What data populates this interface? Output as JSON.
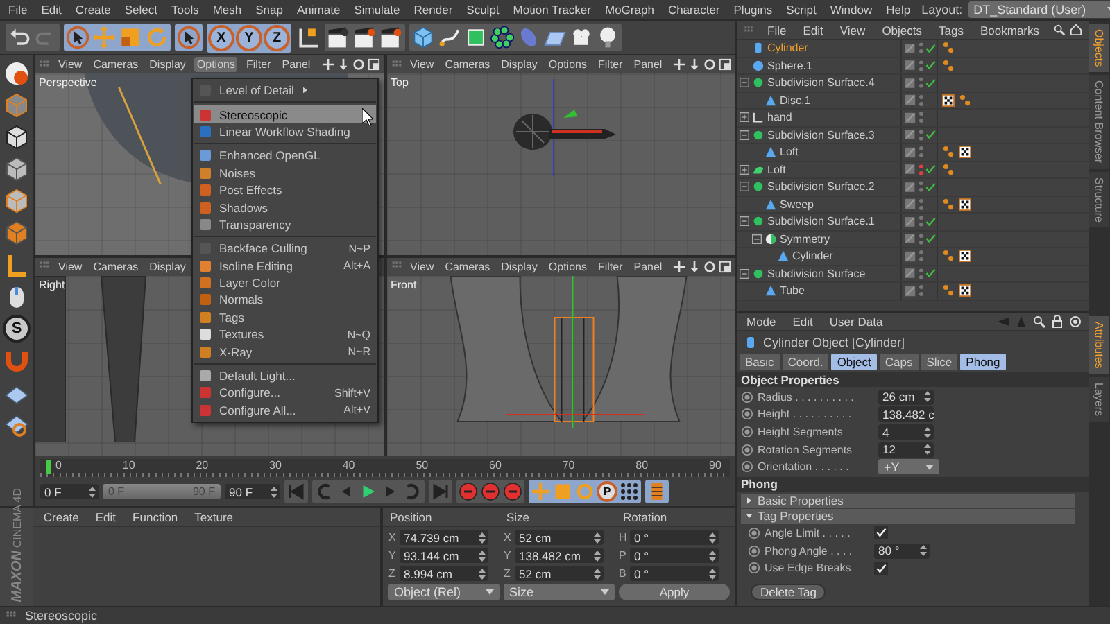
{
  "menu_bar": [
    "File",
    "Edit",
    "Create",
    "Select",
    "Tools",
    "Mesh",
    "Snap",
    "Animate",
    "Simulate",
    "Render",
    "Sculpt",
    "Motion Tracker",
    "MoGraph",
    "Character",
    "Plugins",
    "Script",
    "Window",
    "Help"
  ],
  "layout": {
    "label": "Layout:",
    "value": "DT_Standard (User)"
  },
  "toolbar": {
    "axes": [
      "X",
      "Y",
      "Z"
    ]
  },
  "left_tools": {
    "snap_label": "S"
  },
  "viewports": [
    {
      "name": "Perspective",
      "kind": "perspective",
      "menus": [
        {
          "label": "View",
          "open": false
        },
        {
          "label": "Cameras",
          "open": false
        },
        {
          "label": "Display",
          "open": false
        },
        {
          "label": "Options",
          "open": true
        },
        {
          "label": "Filter",
          "open": false
        },
        {
          "label": "Panel",
          "open": false
        }
      ]
    },
    {
      "name": "Top",
      "kind": "top",
      "menus": [
        {
          "label": "View",
          "open": false
        },
        {
          "label": "Cameras",
          "open": false
        },
        {
          "label": "Display",
          "open": false
        },
        {
          "label": "Options",
          "open": false
        },
        {
          "label": "Filter",
          "open": false
        },
        {
          "label": "Panel",
          "open": false
        }
      ]
    },
    {
      "name": "Right",
      "kind": "right",
      "menus": [
        {
          "label": "View",
          "open": false
        },
        {
          "label": "Cameras",
          "open": false
        },
        {
          "label": "Display",
          "open": false
        }
      ]
    },
    {
      "name": "Front",
      "kind": "front",
      "menus": [
        {
          "label": "View",
          "open": false
        },
        {
          "label": "Cameras",
          "open": false
        },
        {
          "label": "Display",
          "open": false
        },
        {
          "label": "Options",
          "open": false
        },
        {
          "label": "Filter",
          "open": false
        },
        {
          "label": "Panel",
          "open": false
        }
      ]
    }
  ],
  "options_menu": {
    "groups": [
      [
        {
          "label": "Level of Detail",
          "kind": "submenu",
          "selected": false
        }
      ],
      [
        {
          "label": "Stereoscopic",
          "kind": "item",
          "selected": true
        },
        {
          "label": "Linear Workflow Shading",
          "kind": "item",
          "selected": false
        }
      ],
      [
        {
          "label": "Enhanced OpenGL",
          "kind": "item",
          "selected": false
        },
        {
          "label": "Noises",
          "kind": "item",
          "selected": false
        },
        {
          "label": "Post Effects",
          "kind": "item",
          "selected": false
        },
        {
          "label": "Shadows",
          "kind": "item",
          "selected": false
        },
        {
          "label": "Transparency",
          "kind": "item",
          "selected": false
        }
      ],
      [
        {
          "label": "Backface Culling",
          "shortcut": "N~P",
          "kind": "item",
          "selected": false
        },
        {
          "label": "Isoline Editing",
          "shortcut": "Alt+A",
          "kind": "item",
          "selected": false
        },
        {
          "label": "Layer Color",
          "kind": "item",
          "selected": false
        },
        {
          "label": "Normals",
          "kind": "item",
          "selected": false
        },
        {
          "label": "Tags",
          "kind": "item",
          "selected": false
        },
        {
          "label": "Textures",
          "shortcut": "N~Q",
          "kind": "item",
          "selected": false
        },
        {
          "label": "X-Ray",
          "shortcut": "N~R",
          "kind": "item",
          "selected": false
        }
      ],
      [
        {
          "label": "Default Light...",
          "kind": "item",
          "selected": false
        },
        {
          "label": "Configure...",
          "shortcut": "Shift+V",
          "kind": "item",
          "selected": false
        },
        {
          "label": "Configure All...",
          "shortcut": "Alt+V",
          "kind": "item",
          "selected": false
        }
      ]
    ]
  },
  "object_manager": {
    "menu": [
      "File",
      "Edit",
      "View",
      "Objects",
      "Tags",
      "Bookmarks"
    ],
    "objects": [
      {
        "name": "Cylinder",
        "kind": "cylinder",
        "selected": true,
        "enabled": true,
        "editor_visible": true,
        "tags": [
          {
            "kind": "phong"
          }
        ]
      },
      {
        "name": "Sphere.1",
        "kind": "sphere",
        "selected": false,
        "enabled": true,
        "editor_visible": true,
        "tags": [
          {
            "kind": "phong"
          }
        ]
      },
      {
        "name": "Subdivision Surface.4",
        "kind": "subdivision",
        "selected": false,
        "enabled": true,
        "editor_visible": true,
        "expanded": true,
        "children": [
          {
            "name": "Disc.1",
            "kind": "polygon",
            "selected": false,
            "enabled": false,
            "editor_visible": true,
            "tags": [
              {
                "kind": "texture"
              },
              {
                "kind": "phong"
              }
            ]
          }
        ]
      },
      {
        "name": "hand",
        "kind": "null",
        "selected": false,
        "enabled": false,
        "editor_visible": true,
        "expanded": false
      },
      {
        "name": "Subdivision Surface.3",
        "kind": "subdivision",
        "selected": false,
        "enabled": true,
        "editor_visible": true,
        "expanded": true,
        "children": [
          {
            "name": "Loft",
            "kind": "polygon",
            "selected": false,
            "enabled": false,
            "editor_visible": true,
            "tags": [
              {
                "kind": "phong"
              },
              {
                "kind": "texture"
              }
            ]
          }
        ]
      },
      {
        "name": "Loft",
        "kind": "loft",
        "selected": false,
        "enabled": true,
        "editor_visible": false,
        "tags": [
          {
            "kind": "phong"
          }
        ],
        "expanded": false
      },
      {
        "name": "Subdivision Surface.2",
        "kind": "subdivision",
        "selected": false,
        "enabled": true,
        "editor_visible": true,
        "expanded": true,
        "children": [
          {
            "name": "Sweep",
            "kind": "polygon",
            "selected": false,
            "enabled": false,
            "editor_visible": true,
            "tags": [
              {
                "kind": "phong"
              },
              {
                "kind": "texture"
              }
            ]
          }
        ]
      },
      {
        "name": "Subdivision Surface.1",
        "kind": "subdivision",
        "selected": false,
        "enabled": true,
        "editor_visible": true,
        "expanded": true,
        "children": [
          {
            "name": "Symmetry",
            "kind": "symmetry",
            "selected": false,
            "enabled": true,
            "editor_visible": true,
            "expanded": true,
            "children": [
              {
                "name": "Cylinder",
                "kind": "polygon",
                "selected": false,
                "enabled": false,
                "editor_visible": true,
                "tags": [
                  {
                    "kind": "phong"
                  },
                  {
                    "kind": "texture"
                  }
                ]
              }
            ]
          }
        ]
      },
      {
        "name": "Subdivision Surface",
        "kind": "subdivision",
        "selected": false,
        "enabled": true,
        "editor_visible": true,
        "expanded": true,
        "children": [
          {
            "name": "Tube",
            "kind": "polygon",
            "selected": false,
            "enabled": false,
            "editor_visible": true,
            "tags": [
              {
                "kind": "phong"
              },
              {
                "kind": "texture"
              }
            ]
          }
        ]
      }
    ]
  },
  "side_tabs_top": [
    {
      "label": "Objects",
      "selected": true
    },
    {
      "label": "Content Browser",
      "selected": false
    },
    {
      "label": "Structure",
      "selected": false
    }
  ],
  "side_tabs_bottom": [
    {
      "label": "Attributes",
      "selected": true
    },
    {
      "label": "Layers",
      "selected": false
    }
  ],
  "attributes": {
    "menu": [
      "Mode",
      "Edit",
      "User Data"
    ],
    "title": "Cylinder Object [Cylinder]",
    "tabs": [
      {
        "label": "Basic",
        "selected": false
      },
      {
        "label": "Coord.",
        "selected": false
      },
      {
        "label": "Object",
        "selected": true
      },
      {
        "label": "Caps",
        "selected": false
      },
      {
        "label": "Slice",
        "selected": false
      },
      {
        "label": "Phong",
        "selected": true
      }
    ],
    "object_section": "Object Properties",
    "object_fields": [
      {
        "label": "Radius . . . . . . . . . .",
        "value": "26 cm",
        "kind": "number"
      },
      {
        "label": "Height . . . . . . . . . .",
        "value": "138.482 c",
        "kind": "number"
      },
      {
        "label": "Height Segments",
        "value": "4",
        "kind": "number"
      },
      {
        "label": "Rotation Segments",
        "value": "12",
        "kind": "number"
      },
      {
        "label": "Orientation . . . . . .",
        "value": "+Y",
        "kind": "dropdown"
      }
    ],
    "phong_section": "Phong",
    "groups": [
      {
        "label": "Basic Properties",
        "expanded": false
      },
      {
        "label": "Tag Properties",
        "expanded": true
      }
    ],
    "phong_fields": [
      {
        "label": "Angle Limit . . . . .",
        "kind": "checkbox",
        "checked": true
      },
      {
        "label": "Phong Angle . . . .",
        "value": "80 °",
        "kind": "number"
      },
      {
        "label": "Use Edge Breaks",
        "kind": "checkbox",
        "checked": true
      }
    ],
    "delete_button": "Delete Tag"
  },
  "timeline": {
    "ticks": [
      "0",
      "10",
      "20",
      "30",
      "40",
      "50",
      "60",
      "70",
      "80",
      "90"
    ],
    "level": 0,
    "start": "0 F",
    "range": {
      "start": "0 F",
      "end": "90 F",
      "level": 1
    },
    "end": "90 F",
    "key_label": "P"
  },
  "materials": {
    "menu": [
      "Create",
      "Edit",
      "Function",
      "Texture"
    ]
  },
  "logo": {
    "brand": "MAXON",
    "product": "CINEMA 4D"
  },
  "coordinates": {
    "headers": [
      "Position",
      "Size",
      "Rotation"
    ],
    "rows": [
      {
        "pos_axis": "X",
        "pos": "74.739 cm",
        "size_axis": "X",
        "size": "52 cm",
        "rot_axis": "H",
        "rot": "0 °"
      },
      {
        "pos_axis": "Y",
        "pos": "93.144 cm",
        "size_axis": "Y",
        "size": "138.482 cm",
        "rot_axis": "P",
        "rot": "0 °"
      },
      {
        "pos_axis": "Z",
        "pos": "8.994 cm",
        "size_axis": "Z",
        "size": "52 cm",
        "rot_axis": "B",
        "rot": "0 °"
      }
    ],
    "mode": "Object (Rel)",
    "size_mode": "Size",
    "apply": "Apply"
  },
  "status_bar": "Stereoscopic"
}
